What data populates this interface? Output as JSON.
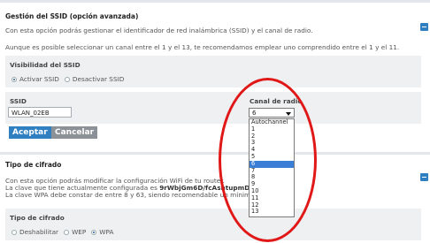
{
  "ssid_section": {
    "title": "Gestión del SSID (opción avanzada)",
    "desc1": "Con esta opción podrás gestionar el identificador de red inalámbrica (SSID) y el canal de radio.",
    "desc2": "Aunque es posible seleccionar un canal entre el 1 y el 13, te recomendamos emplear uno comprendido entre el 1 y el 11.",
    "visibility_label": "Visibilidad del SSID",
    "activate_label": "Activar SSID",
    "deactivate_label": "Desactivar SSID",
    "ssid_label": "SSID",
    "ssid_value": "WLAN_02EB",
    "channel_label": "Canal de radio",
    "channel_selected": "6",
    "channel_options": [
      "Autochannel",
      "1",
      "2",
      "3",
      "4",
      "5",
      "6",
      "7",
      "8",
      "9",
      "10",
      "11",
      "12",
      "13"
    ],
    "accept_label": "Aceptar",
    "cancel_label": "Cancelar"
  },
  "cipher_section": {
    "title": "Tipo de cifrado",
    "desc1": "Con esta opción podrás modificar la configuración WiFi de tu router.",
    "desc2_prefix": "La clave que tiene actualmente configurada es ",
    "desc2_key": "9rWbjGm6D/fcAshtupmD",
    "desc3": "La clave WPA debe constar de entre 8 y 63, siendo recomendable un mínimo",
    "type_label": "Tipo de cifrado",
    "options": [
      "Deshabilitar",
      "WEP",
      "WPA"
    ]
  },
  "colors": {
    "accent": "#2f7fc1",
    "annotation": "#e01818",
    "selected_option": "#3a7fd5"
  }
}
